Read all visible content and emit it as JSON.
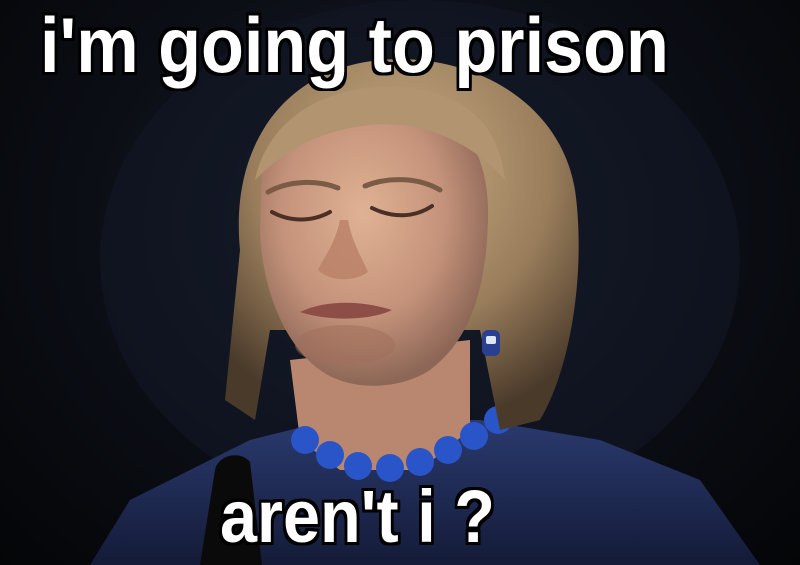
{
  "meme": {
    "top_text": "i'm going to prison",
    "bottom_text": "aren't i ?"
  },
  "colors": {
    "background": "#0b0e15",
    "caption_fill": "#ffffff",
    "caption_outline": "#000000",
    "jacket": "#1d2a55",
    "necklace": "#2a55c8",
    "skin": "#c99a7e",
    "hair": "#a88a66"
  }
}
